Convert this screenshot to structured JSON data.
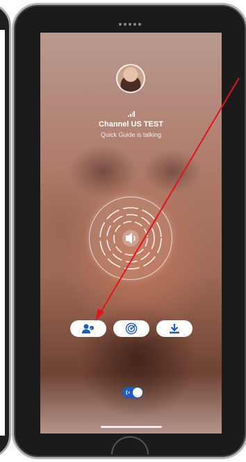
{
  "call": {
    "channel_name": "Channel US TEST",
    "status": "Quick Guide is talking"
  },
  "icons": {
    "avatar": "user-avatar",
    "signal": "signal-bars-icon",
    "talk": "speaker-icon",
    "participants": "participants-icon",
    "radar": "radar-icon",
    "download": "download-icon",
    "toggle": "sound-wave-icon"
  },
  "colors": {
    "accent": "#1e5bbf",
    "annotation": "#e8111b"
  },
  "toggle": {
    "state": "on"
  }
}
